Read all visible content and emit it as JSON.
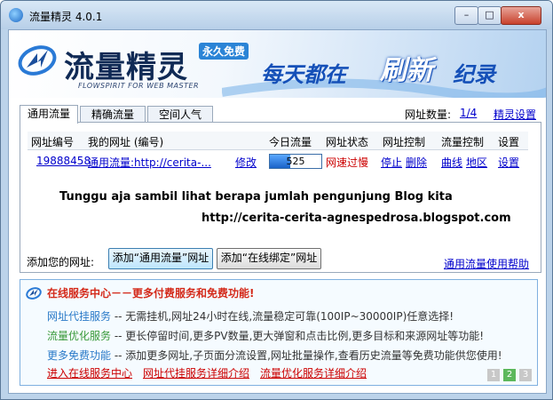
{
  "window": {
    "title": "流量精灵 4.0.1",
    "minimize": "–",
    "maximize": "□",
    "close": "x"
  },
  "banner": {
    "logo": "流量精灵",
    "badge": "永久免费",
    "subtitle": "FLOWSPIRIT FOR WEB MASTER",
    "slogan_part1": "每天都在",
    "slogan_part2": "刷新",
    "slogan_part3": "纪录"
  },
  "tabs": [
    {
      "label": "通用流量",
      "active": true
    },
    {
      "label": "精确流量",
      "active": false
    },
    {
      "label": "空间人气",
      "active": false
    }
  ],
  "header": {
    "count_label": "网址数量:",
    "count_value": "1/4",
    "settings_link": "精灵设置"
  },
  "table": {
    "headers": [
      "网址编号",
      "我的网址 (编号)",
      "今日流量",
      "网址状态",
      "网址控制",
      "流量控制",
      "设置"
    ],
    "rows": [
      {
        "id": "19888458",
        "url": "通用流量:http://cerita-...",
        "edit": "修改",
        "traffic": "525",
        "traffic_fraction": 0.4,
        "status": "网速过慢",
        "stop": "停止",
        "delete": "删除",
        "curve": "曲线",
        "region": "地区",
        "setting": "设置"
      }
    ]
  },
  "notes": {
    "line1": "Tunggu aja sambil lihat berapa jumlah pengunjung Blog kita",
    "line2": "http://cerita-cerita-agnespedrosa.blogspot.com"
  },
  "add": {
    "label": "添加您的网址:",
    "button1": "添加“通用流量”网址",
    "button2": "添加“在线绑定”网址",
    "help_link": "通用流量使用帮助"
  },
  "service": {
    "title": "在线服务中心－－更多付费服务和免费功能!",
    "lines": [
      {
        "key": "网址代挂服务",
        "text": " -- 无需挂机,网址24小时在线,流量稳定可靠(100IP~30000IP)任意选择!"
      },
      {
        "key": "流量优化服务",
        "text": " -- 更长停留时间,更多PV数量,更大弹窗和点击比例,更多目标和来源网址等功能!"
      },
      {
        "key": "更多免费功能",
        "text": " -- 添加更多网址,子页面分流设置,网址批量操作,查看历史流量等免费功能供您使用!"
      }
    ],
    "links": [
      "进入在线服务中心",
      "网址代挂服务详细介绍",
      "流量优化服务详细介绍"
    ],
    "pages": [
      "1",
      "2",
      "3"
    ]
  },
  "colors": {
    "accent": "#1a63c8",
    "link": "#0000cc",
    "warning": "#cc0000",
    "page_active": "#5cb85c",
    "page_inactive": "#c8c8c8"
  }
}
